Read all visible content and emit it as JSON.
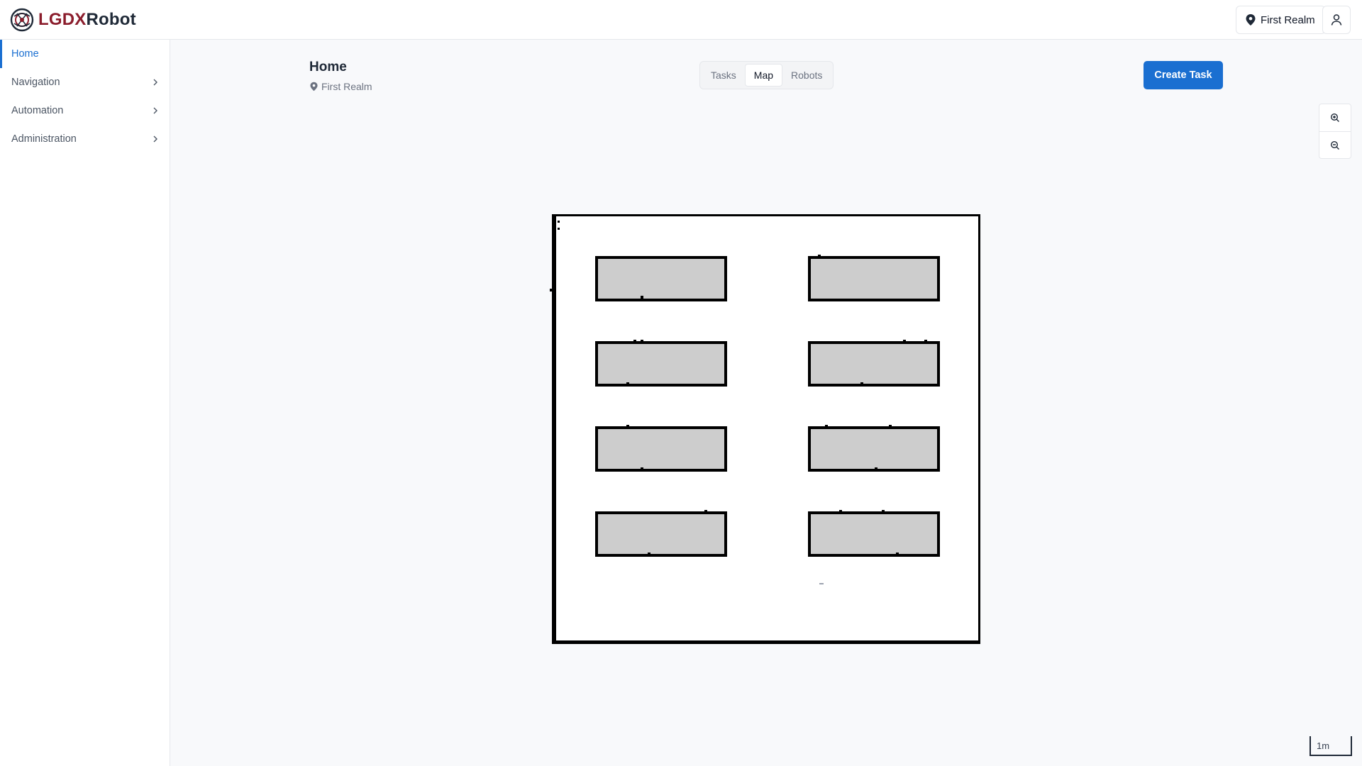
{
  "header": {
    "brand_part1": "LGDX",
    "brand_part2": "Robot",
    "realm_label": "First Realm",
    "brand_color": "#8b1d2c",
    "accent_color": "#1a6fd1"
  },
  "sidebar": {
    "items": [
      {
        "label": "Home",
        "active": true
      },
      {
        "label": "Navigation",
        "expandable": true
      },
      {
        "label": "Automation",
        "expandable": true
      },
      {
        "label": "Administration",
        "expandable": true
      }
    ]
  },
  "page": {
    "title": "Home",
    "realm": "First Realm"
  },
  "tabs": [
    {
      "label": "Tasks"
    },
    {
      "label": "Map",
      "active": true
    },
    {
      "label": "Robots"
    }
  ],
  "actions": {
    "create_task": "Create Task"
  },
  "map": {
    "scale_label": "1m"
  },
  "icons": {
    "logo": "lgdx-logo-icon",
    "realm": "map-pin-icon",
    "user": "user-icon",
    "zoom_in": "zoom-in-icon",
    "zoom_out": "zoom-out-icon",
    "chevron": "chevron-right-icon"
  }
}
